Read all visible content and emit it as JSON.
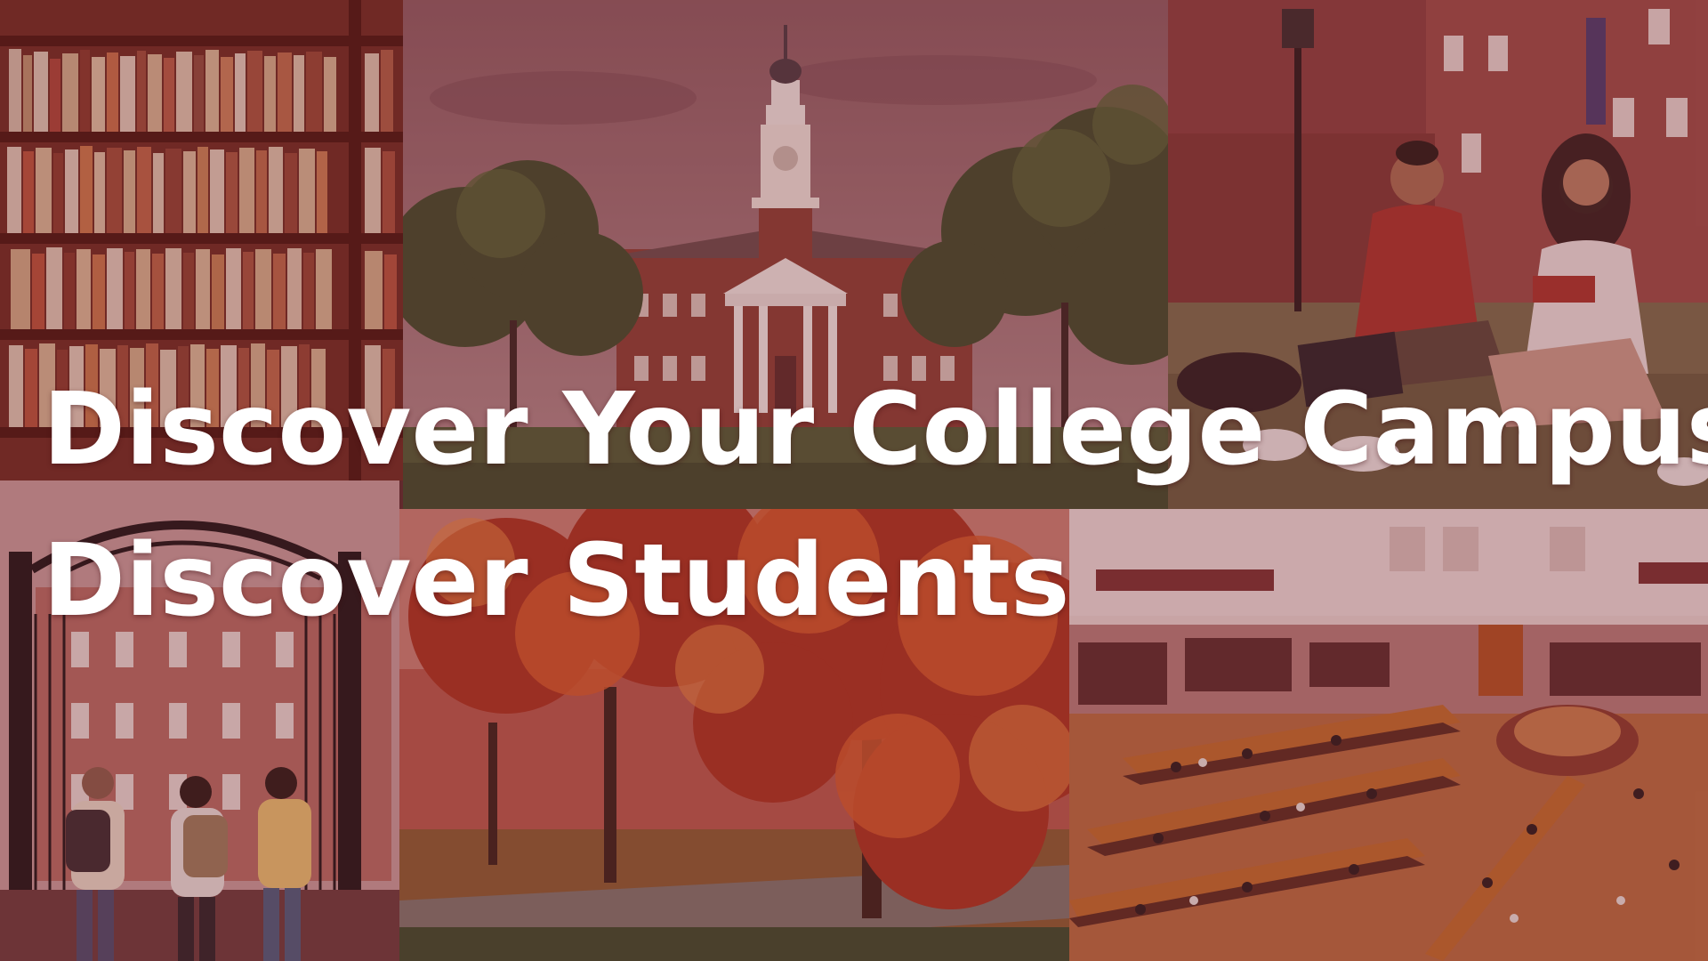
{
  "headline": {
    "line1": "Discover Your College Campus",
    "line2": "Discover Students"
  },
  "overlay_color": "#7a2832",
  "text_color": "#ffffff",
  "photos": [
    "bookshelf-photo",
    "clock-tower-hall-photo",
    "students-on-lawn-photo",
    "campus-gate-photo",
    "autumn-trees-photo",
    "reading-room-library-photo"
  ]
}
